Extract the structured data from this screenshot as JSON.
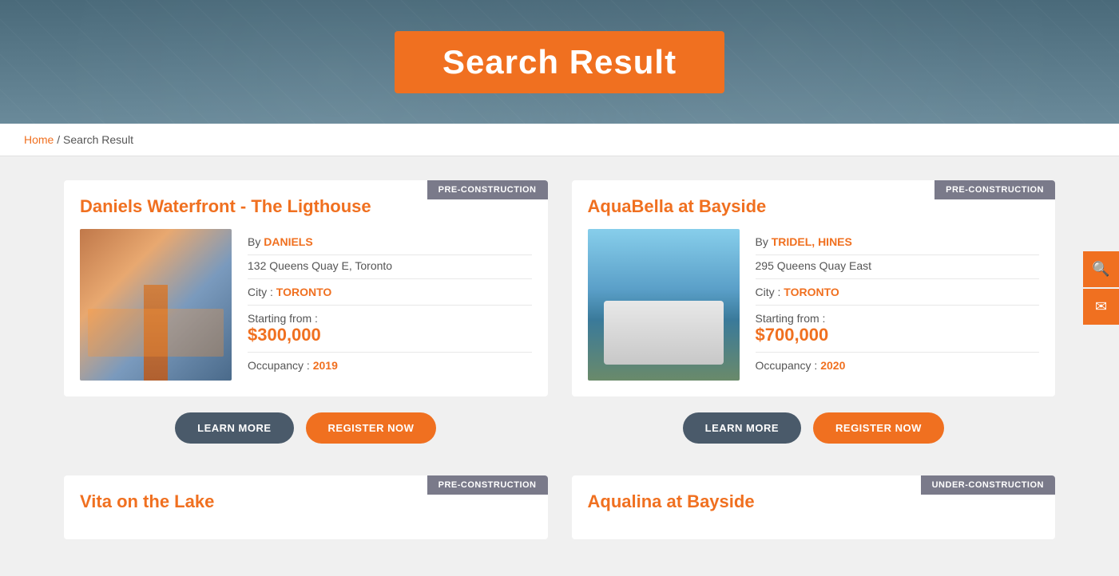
{
  "hero": {
    "title": "Search Result",
    "background_color": "#5a7a8a"
  },
  "breadcrumb": {
    "home_label": "Home",
    "separator": "/",
    "current": "Search Result"
  },
  "cards": [
    {
      "id": "card1",
      "badge": "PRE-CONSTRUCTION",
      "badge_type": "pre",
      "title": "Daniels Waterfront - The Ligthouse",
      "by_label": "By",
      "developer": "DANIELS",
      "address": "132 Queens Quay E, Toronto",
      "city_label": "City :",
      "city": "TORONTO",
      "starting_label": "Starting from :",
      "price": "$300,000",
      "occupancy_label": "Occupancy :",
      "occupancy": "2019",
      "img_type": "lighthouse"
    },
    {
      "id": "card2",
      "badge": "PRE-CONSTRUCTION",
      "badge_type": "pre",
      "title": "AquaBella at Bayside",
      "by_label": "By",
      "developer": "TRIDEL, HINES",
      "address": "295 Queens Quay East",
      "city_label": "City :",
      "city": "TORONTO",
      "starting_label": "Starting from :",
      "price": "$700,000",
      "occupancy_label": "Occupancy :",
      "occupancy": "2020",
      "img_type": "aquabella"
    }
  ],
  "actions": [
    {
      "card_id": "card1",
      "learn_label": "LEARN MORE",
      "register_label": "REGISTER NOW"
    },
    {
      "card_id": "card2",
      "learn_label": "LEARN MORE",
      "register_label": "REGISTER NOW"
    }
  ],
  "partial_cards": [
    {
      "id": "card3",
      "badge": "PRE-CONSTRUCTION",
      "badge_type": "pre",
      "title": "Vita on the Lake"
    },
    {
      "id": "card4",
      "badge": "UNDER-CONSTRUCTION",
      "badge_type": "under",
      "title": "Aqualina at Bayside"
    }
  ],
  "side_buttons": {
    "search_icon": "🔍",
    "mail_icon": "✉"
  }
}
